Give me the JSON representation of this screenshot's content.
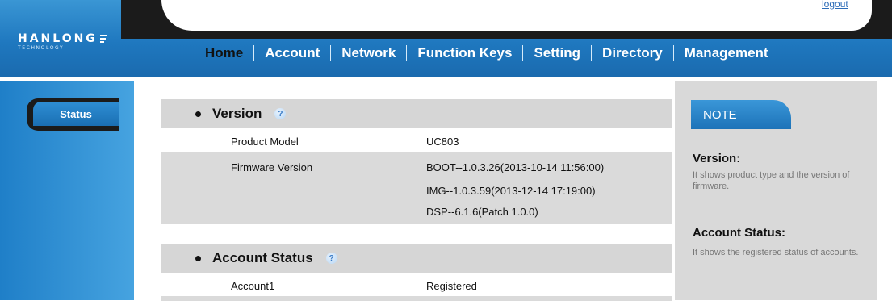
{
  "header": {
    "logout_label": "logout",
    "logo_name": "HANLONG",
    "logo_sub": "TECHNOLOGY",
    "nav": [
      "Home",
      "Account",
      "Network",
      "Function Keys",
      "Setting",
      "Directory",
      "Management"
    ],
    "active_nav": "Home"
  },
  "sidebar": {
    "items": [
      {
        "label": "Status"
      }
    ]
  },
  "main": {
    "sections": [
      {
        "title": "Version",
        "help_icon": "question-icon",
        "rows": [
          {
            "key": "Product Model",
            "values": [
              "UC803"
            ]
          },
          {
            "key": "Firmware Version",
            "values": [
              "BOOT--1.0.3.26(2013-10-14 11:56:00)",
              "IMG--1.0.3.59(2013-12-14 17:19:00)",
              "DSP--6.1.6(Patch 1.0.0)"
            ]
          }
        ]
      },
      {
        "title": "Account Status",
        "help_icon": "question-icon",
        "rows": [
          {
            "key": "Account1",
            "values": [
              "Registered"
            ]
          }
        ]
      }
    ]
  },
  "note": {
    "tab_label": "NOTE",
    "items": [
      {
        "heading": "Version:",
        "text": "It shows product type and the version of firmware."
      },
      {
        "heading": "Account Status:",
        "text": "It shows the registered status of accounts."
      }
    ]
  },
  "colors": {
    "brand_blue": "#1f78bf",
    "panel_gray": "#d6d6d6",
    "dark": "#1b1b1b"
  }
}
